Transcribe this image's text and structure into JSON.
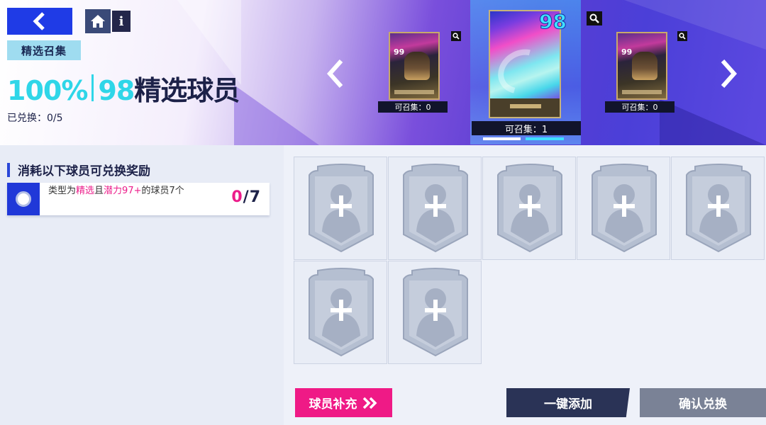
{
  "header": {
    "back_icon": "chevron-left-icon",
    "home_icon": "home-icon",
    "info_label": "i",
    "event_tag": "精选召集",
    "title_percent": "100%",
    "title_rating": "98",
    "title_name": "精选球员",
    "redeem_progress": "已兑换：0/5"
  },
  "packs": {
    "left": {
      "ovr": "99",
      "count_label": "可召集：0"
    },
    "center": {
      "ovr": "98",
      "count_label": "可召集：1"
    },
    "right": {
      "ovr": "99",
      "count_label": "可召集：0"
    }
  },
  "requirements": {
    "heading": "消耗以下球员可兑换奖励",
    "item": {
      "text_1": "类型为",
      "text_hl_1": "精选",
      "text_2": "且",
      "text_hl_2": "潜力97+",
      "text_3": "的球员7个",
      "current": "0",
      "total": "/7"
    }
  },
  "slots": {
    "count": 7,
    "empty_icon": "add-player-icon"
  },
  "buttons": {
    "supply": "球员补充",
    "autofill": "一键添加",
    "confirm": "确认兑换"
  },
  "colors": {
    "accent_pink": "#ef1a86",
    "accent_blue": "#2038d8",
    "accent_cyan": "#2fd6e8",
    "navy": "#2a3356"
  }
}
